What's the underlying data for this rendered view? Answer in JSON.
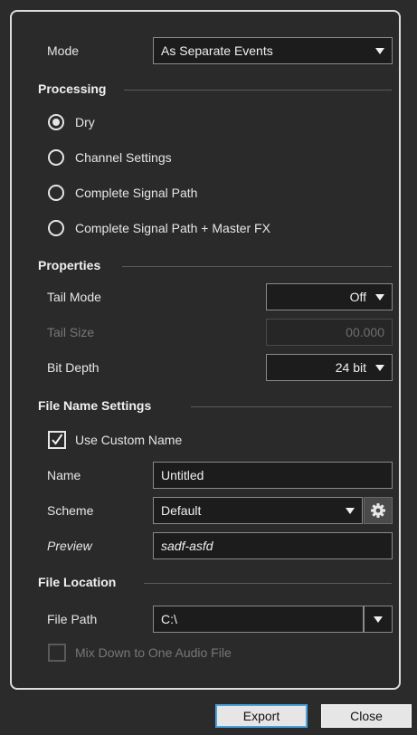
{
  "mode": {
    "label": "Mode",
    "value": "As Separate Events"
  },
  "processing": {
    "title": "Processing",
    "options": [
      {
        "label": "Dry",
        "selected": true
      },
      {
        "label": "Channel Settings",
        "selected": false
      },
      {
        "label": "Complete Signal Path",
        "selected": false
      },
      {
        "label": "Complete Signal Path + Master FX",
        "selected": false
      }
    ]
  },
  "properties": {
    "title": "Properties",
    "tail_mode": {
      "label": "Tail Mode",
      "value": "Off"
    },
    "tail_size": {
      "label": "Tail Size",
      "value": "00.000"
    },
    "bit_depth": {
      "label": "Bit Depth",
      "value": "24 bit"
    }
  },
  "file_name_settings": {
    "title": "File Name Settings",
    "use_custom_name": {
      "label": "Use Custom Name",
      "checked": true
    },
    "name": {
      "label": "Name",
      "value": "Untitled"
    },
    "scheme": {
      "label": "Scheme",
      "value": "Default",
      "icon": "gear-icon"
    },
    "preview": {
      "label": "Preview",
      "value": "sadf-asfd"
    }
  },
  "file_location": {
    "title": "File Location",
    "file_path": {
      "label": "File Path",
      "value": "C:\\"
    },
    "mix_down": {
      "label": "Mix Down to One Audio File",
      "checked": false
    }
  },
  "buttons": {
    "export": "Export",
    "close": "Close"
  },
  "colors": {
    "accent": "#4aa3df",
    "panel_bg": "#2a2a2a",
    "page_bg": "#2b2b2b"
  }
}
